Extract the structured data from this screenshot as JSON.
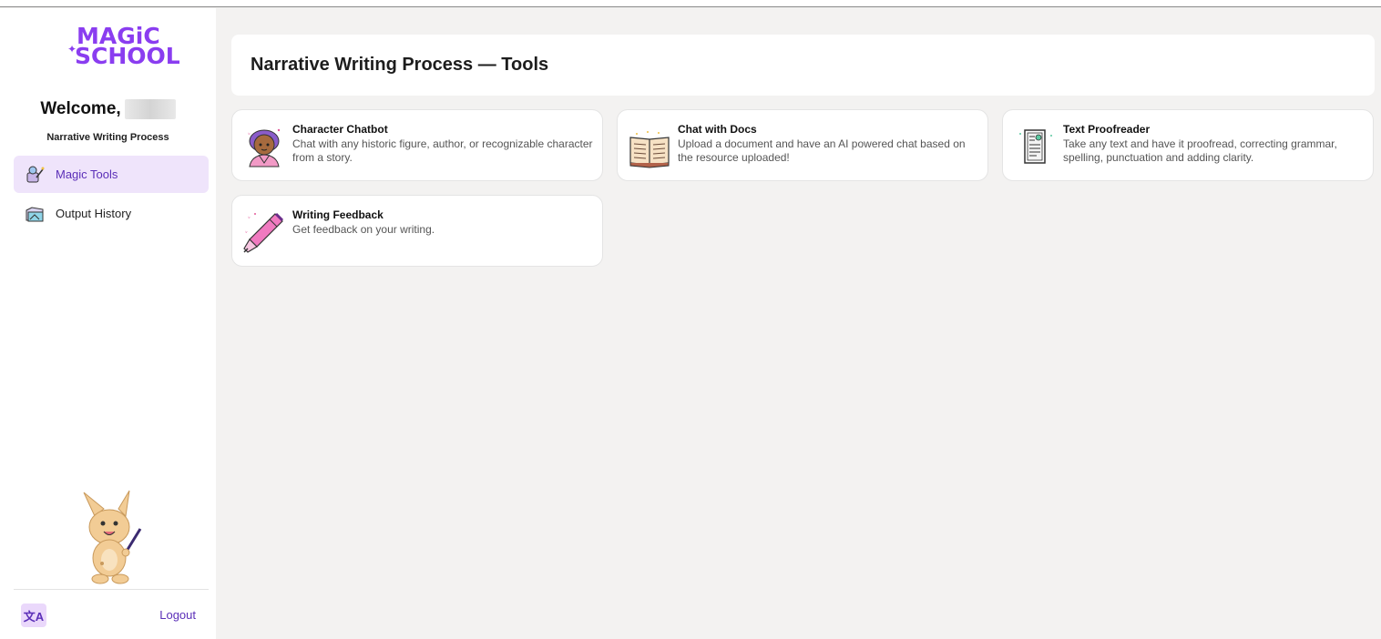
{
  "sidebar": {
    "logo_line1": "MAGiC",
    "logo_line2": "SCHOOL",
    "welcome": "Welcome,",
    "room_name": "Narrative Writing Process",
    "nav": [
      {
        "label": "Magic Tools",
        "icon": "wand-icon",
        "active": true
      },
      {
        "label": "Output History",
        "icon": "history-icon",
        "active": false
      }
    ],
    "translate_icon": "文A",
    "logout_label": "Logout"
  },
  "main": {
    "title": "Narrative Writing Process — Tools",
    "tools": [
      {
        "name": "Character Chatbot",
        "description": "Chat with any historic figure, author, or recognizable character from a story.",
        "icon": "character-icon"
      },
      {
        "name": "Chat with Docs",
        "description": "Upload a document and have an AI powered chat based on the resource uploaded!",
        "icon": "book-icon"
      },
      {
        "name": "Text Proofreader",
        "description": "Take any text and have it proofread, correcting grammar, spelling, punctuation and adding clarity.",
        "icon": "document-icon"
      },
      {
        "name": "Writing Feedback",
        "description": "Get feedback on your writing.",
        "icon": "pen-icon"
      }
    ]
  },
  "colors": {
    "accent": "#8a3df0",
    "active_bg": "#efe4fb",
    "page_bg": "#f3f2f1"
  }
}
